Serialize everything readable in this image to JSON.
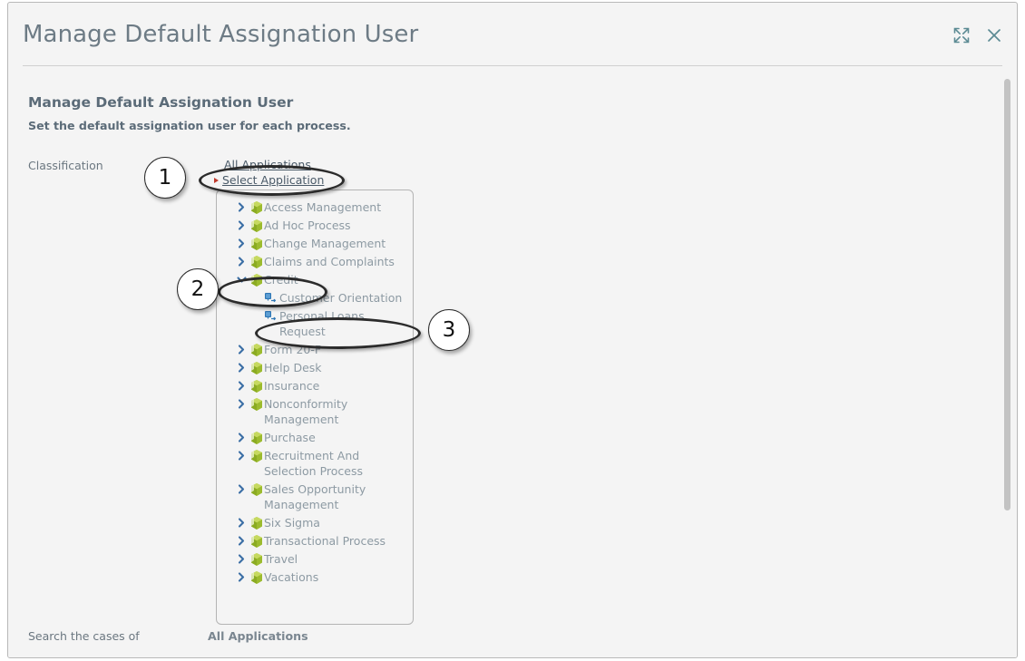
{
  "window": {
    "title": "Manage Default Assignation User",
    "expand_icon": "expand-icon",
    "close_icon": "close-icon"
  },
  "content": {
    "section_title": "Manage Default Assignation User",
    "section_subtitle": "Set the default assignation user for each process.",
    "classification_label": "Classification",
    "search_cases_label": "Search the cases of",
    "search_cases_value": "All Applications",
    "all_applications_link": "All Applications",
    "select_application_link": "Select Application"
  },
  "tree": {
    "nodes": [
      {
        "label": "Access Management",
        "icon": "green-cube-icon",
        "state": "collapsed",
        "level": 0
      },
      {
        "label": "Ad Hoc Process",
        "icon": "green-cube-icon",
        "state": "collapsed",
        "level": 0
      },
      {
        "label": "Change Management",
        "icon": "green-cube-icon",
        "state": "collapsed",
        "level": 0
      },
      {
        "label": "Claims and Complaints",
        "icon": "green-cube-icon",
        "state": "collapsed",
        "level": 0
      },
      {
        "label": "Credit",
        "icon": "green-cube-icon",
        "state": "expanded",
        "level": 0
      },
      {
        "label": "Customer Orientation",
        "icon": "blue-process-icon",
        "state": "leaf",
        "level": 1
      },
      {
        "label": "Personal Loans Request",
        "icon": "blue-process-icon",
        "state": "leaf",
        "level": 1
      },
      {
        "label": "Form 20-F",
        "icon": "green-cube-icon",
        "state": "collapsed",
        "level": 0
      },
      {
        "label": "Help Desk",
        "icon": "green-cube-icon",
        "state": "collapsed",
        "level": 0
      },
      {
        "label": "Insurance",
        "icon": "green-cube-icon",
        "state": "collapsed",
        "level": 0
      },
      {
        "label": "Nonconformity Management",
        "icon": "green-cube-icon",
        "state": "collapsed",
        "level": 0
      },
      {
        "label": "Purchase",
        "icon": "green-cube-icon",
        "state": "collapsed",
        "level": 0
      },
      {
        "label": "Recruitment And Selection Process",
        "icon": "green-cube-icon",
        "state": "collapsed",
        "level": 0
      },
      {
        "label": "Sales Opportunity Management",
        "icon": "green-cube-icon",
        "state": "collapsed",
        "level": 0
      },
      {
        "label": "Six Sigma",
        "icon": "green-cube-icon",
        "state": "collapsed",
        "level": 0
      },
      {
        "label": "Transactional Process",
        "icon": "green-cube-icon",
        "state": "collapsed",
        "level": 0
      },
      {
        "label": "Travel",
        "icon": "green-cube-icon",
        "state": "collapsed",
        "level": 0
      },
      {
        "label": "Vacations",
        "icon": "green-cube-icon",
        "state": "collapsed",
        "level": 0
      }
    ]
  },
  "annotations": {
    "steps": [
      {
        "number": "1",
        "target": "Select Application"
      },
      {
        "number": "2",
        "target": "Credit"
      },
      {
        "number": "3",
        "target": "Personal Loans Request"
      }
    ]
  },
  "colors": {
    "title": "#6d7b85",
    "heading": "#5b6b78",
    "link": "#4a5a68",
    "tree_label": "#8d9aa3",
    "chevron": "#3a6ea5",
    "cube_green": "#9fc22a",
    "process_blue": "#2f77b5",
    "annotation": "#2b2b2b",
    "background": "#f4f4f4"
  }
}
